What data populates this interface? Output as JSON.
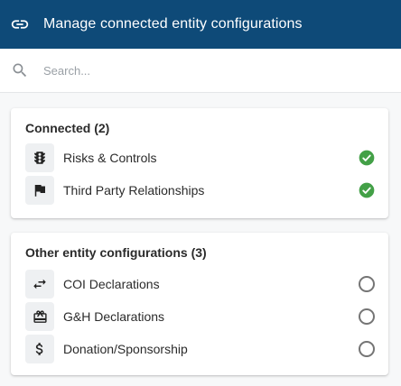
{
  "header": {
    "title": "Manage connected entity configurations",
    "icon": "link-icon"
  },
  "search": {
    "placeholder": "Search...",
    "value": "",
    "icon": "search-icon"
  },
  "colors": {
    "header_bg": "#0e4a78",
    "check_green": "#43a047",
    "radio_grey": "#757575",
    "tile_bg": "#eef0f2"
  },
  "connected": {
    "title": "Connected (2)",
    "items": [
      {
        "label": "Risks & Controls",
        "icon": "traffic-light-icon",
        "selected": true
      },
      {
        "label": "Third Party Relationships",
        "icon": "flag-icon",
        "selected": true
      }
    ]
  },
  "other": {
    "title": "Other entity configurations (3)",
    "items": [
      {
        "label": "COI Declarations",
        "icon": "swap-arrows-icon",
        "selected": false
      },
      {
        "label": "G&H Declarations",
        "icon": "gift-icon",
        "selected": false
      },
      {
        "label": "Donation/Sponsorship",
        "icon": "dollar-icon",
        "selected": false
      }
    ]
  }
}
